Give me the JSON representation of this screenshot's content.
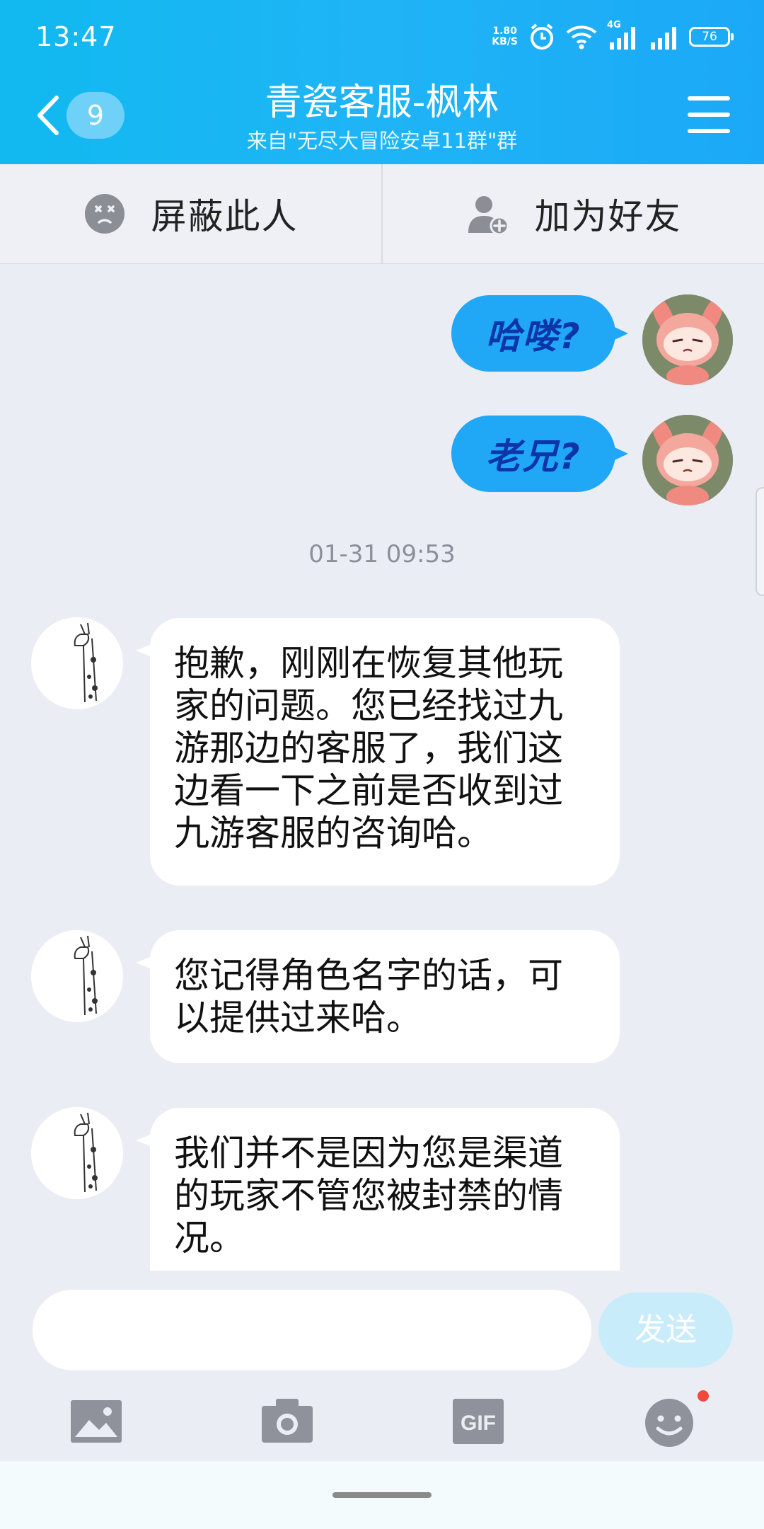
{
  "status_bar": {
    "time": "13:47",
    "net_speed_value": "1.80",
    "net_speed_unit": "KB/S",
    "network_type": "4G",
    "battery": "76"
  },
  "header": {
    "back_badge_count": "9",
    "title": "青瓷客服-枫林",
    "subtitle": "来自\"无尽大冒险安卓11群\"群"
  },
  "actions": {
    "block_label": "屏蔽此人",
    "add_friend_label": "加为好友"
  },
  "messages": {
    "outgoing": [
      {
        "text": "哈喽?"
      },
      {
        "text": "老兄?"
      }
    ],
    "timestamp": "01-31 09:53",
    "incoming": [
      {
        "text": "抱歉，刚刚在恢复其他玩家的问题。您已经找过九游那边的客服了，我们这边看一下之前是否收到过九游客服的咨询哈。"
      },
      {
        "text": "您记得角色名字的话，可以提供过来哈。"
      },
      {
        "text": "我们并不是因为您是渠道的玩家不管您被封禁的情况。"
      }
    ]
  },
  "composer": {
    "input_value": "",
    "send_label": "发送"
  },
  "toolbar": {
    "gif_label": "GIF",
    "icons": [
      "image-icon",
      "camera-icon",
      "gif-icon",
      "emoji-icon"
    ]
  },
  "colors": {
    "header": "#1fb4f6",
    "outgoing_bubble": "#20a8f7",
    "send_disabled": "#c9ecfb",
    "notification_dot": "#f04a3c"
  }
}
